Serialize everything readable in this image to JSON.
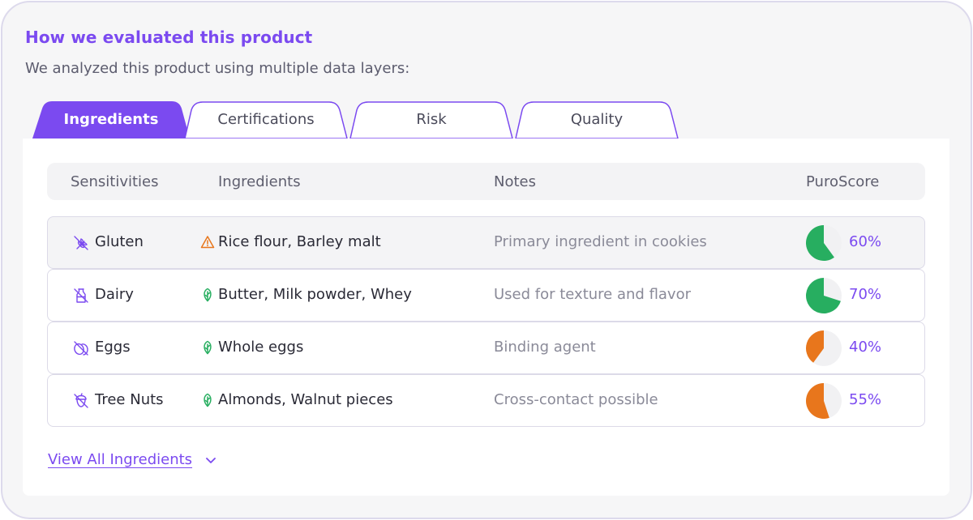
{
  "header": {
    "title": "How we evaluated this product",
    "subtitle": "We analyzed this product using multiple data layers:"
  },
  "tabs": [
    {
      "label": "Ingredients",
      "active": true
    },
    {
      "label": "Certifications",
      "active": false
    },
    {
      "label": "Risk",
      "active": false
    },
    {
      "label": "Quality",
      "active": false
    }
  ],
  "table": {
    "columns": {
      "sensitivities": "Sensitivities",
      "ingredients": "Ingredients",
      "notes": "Notes",
      "score": "PuroScore"
    },
    "rows": [
      {
        "sensitivity": "Gluten",
        "sensitivity_icon": "wheat-off-icon",
        "ingredients": "Rice flour, Barley malt",
        "ingredient_icon": "warning-icon",
        "note": "Primary ingredient in cookies",
        "score_text": "60%",
        "score": 0.6,
        "score_color": "#27ae60"
      },
      {
        "sensitivity": "Dairy",
        "sensitivity_icon": "milk-off-icon",
        "ingredients": "Butter, Milk powder, Whey",
        "ingredient_icon": "leaf-icon",
        "note": "Used for texture and flavor",
        "score_text": "70%",
        "score": 0.7,
        "score_color": "#27ae60"
      },
      {
        "sensitivity": "Eggs",
        "sensitivity_icon": "egg-off-icon",
        "ingredients": "Whole eggs",
        "ingredient_icon": "leaf-icon",
        "note": "Binding agent",
        "score_text": "40%",
        "score": 0.4,
        "score_color": "#e8761c"
      },
      {
        "sensitivity": "Tree Nuts",
        "sensitivity_icon": "nut-off-icon",
        "ingredients": "Almonds, Walnut pieces",
        "ingredient_icon": "leaf-icon",
        "note": "Cross-contact possible",
        "score_text": "55%",
        "score": 0.55,
        "score_color": "#e8761c"
      }
    ]
  },
  "footer": {
    "view_all_label": "View All Ingredients"
  },
  "colors": {
    "accent": "#7b4af0",
    "success": "#27ae60",
    "warning": "#e8761c",
    "pie_track": "#f1f1f3"
  }
}
